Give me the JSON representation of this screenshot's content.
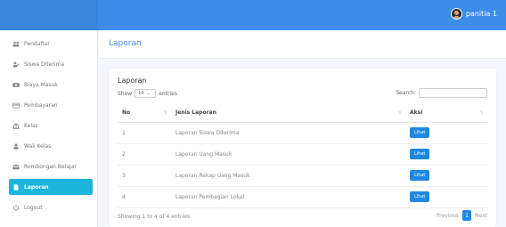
{
  "topbar": {
    "username": "panitia 1"
  },
  "sidebar": {
    "items": [
      {
        "label": "Pendaftar",
        "icon": "users-icon"
      },
      {
        "label": "Siswa Diterima",
        "icon": "user-check-icon"
      },
      {
        "label": "Biaya Masuk",
        "icon": "money-icon"
      },
      {
        "label": "Pembayaran",
        "icon": "payment-icon"
      },
      {
        "label": "Kelas",
        "icon": "building-icon"
      },
      {
        "label": "Wali Kelas",
        "icon": "user-icon"
      },
      {
        "label": "Rombongan Belajar",
        "icon": "group-icon"
      },
      {
        "label": "Laporan",
        "icon": "file-icon"
      },
      {
        "label": "Logout",
        "icon": "power-icon"
      }
    ]
  },
  "page": {
    "title": "Laporan"
  },
  "card": {
    "title": "Laporan",
    "show_label": "Show",
    "entries_value": "10",
    "entries_label": "entries",
    "search_label": "Search:"
  },
  "table": {
    "headers": [
      "No",
      "Jenis Laporan",
      "Aksi"
    ],
    "rows": [
      {
        "no": "1",
        "jenis": "Laporan Siswa Diterima",
        "aksi": "Lihat"
      },
      {
        "no": "2",
        "jenis": "Laporan Uang Masuk",
        "aksi": "Lihat"
      },
      {
        "no": "3",
        "jenis": "Laporan Rekap Uang Masuk",
        "aksi": "Lihat"
      },
      {
        "no": "4",
        "jenis": "Laporan Pembagian Lokal",
        "aksi": "Lihat"
      }
    ]
  },
  "footer": {
    "info": "Showing 1 to 4 of 4 entries",
    "previous": "Previous",
    "page": "1",
    "next": "Next"
  },
  "colors": {
    "accent": "#3b8de8",
    "active": "#1cb5dc",
    "button": "#1e88e5"
  }
}
